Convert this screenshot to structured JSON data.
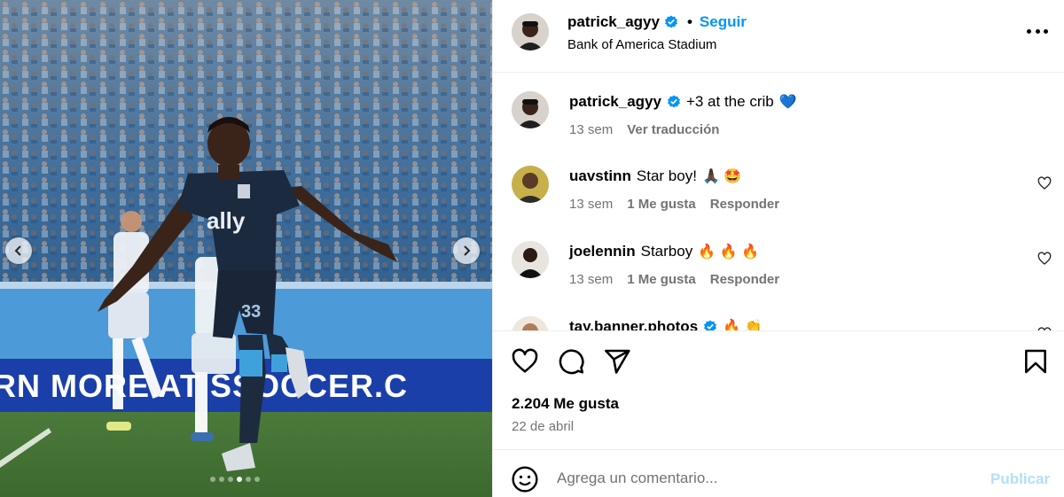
{
  "post": {
    "author": {
      "username": "patrick_agyy",
      "verified": true,
      "follow_label": "Seguir",
      "separator": "•"
    },
    "location": "Bank of America Stadium",
    "media": {
      "carousel_dots": 6,
      "active_dot": 3,
      "photo_text": {
        "jersey_sponsor": "ally",
        "jersey_number": "33",
        "ad_board": "RN MORE AT   SSOCCER.C"
      }
    },
    "caption": {
      "username": "patrick_agyy",
      "verified": true,
      "text": "+3 at the crib",
      "emoji": "💙",
      "time": "13 sem",
      "translate_label": "Ver traducción"
    },
    "comments": [
      {
        "username": "uavstinn",
        "text": "Star boy!",
        "emoji": "🙏🏿 🤩",
        "time": "13 sem",
        "likes_label": "1 Me gusta",
        "reply_label": "Responder"
      },
      {
        "username": "joelennin",
        "text": "Starboy",
        "emoji": "🔥 🔥 🔥",
        "time": "13 sem",
        "likes_label": "1 Me gusta",
        "reply_label": "Responder"
      },
      {
        "username": "tay.banner.photos",
        "verified": true,
        "text": "",
        "emoji": "🔥 👏",
        "time": "",
        "likes_label": "",
        "reply_label": ""
      }
    ],
    "likes_count": "2.204 Me gusta",
    "date": "22 de abril",
    "composer": {
      "placeholder": "Agrega un comentario...",
      "publish_label": "Publicar"
    }
  },
  "icons": {
    "header": [
      "avatar",
      "verified-badge-icon",
      "more-options-icon"
    ],
    "actions": [
      "heart-icon",
      "comment-icon",
      "share-icon",
      "bookmark-icon"
    ],
    "composer": [
      "emoji-icon"
    ],
    "media": [
      "chevron-left-icon",
      "chevron-right-icon"
    ]
  },
  "colors": {
    "accent": "#0095f6",
    "verified": "#0095f6",
    "secondary_text": "#737373",
    "publish_disabled": "#b2dffc",
    "divider": "#efefef"
  }
}
